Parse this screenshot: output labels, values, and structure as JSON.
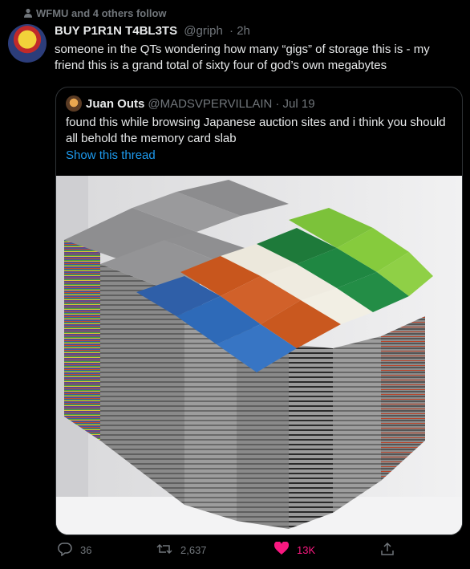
{
  "social_context": {
    "icon": "person-icon",
    "text": "WFMU and 4 others follow"
  },
  "tweet": {
    "author_name": "BUY P1R1N T4BL3TS",
    "handle": "@griph",
    "time": "· 2h",
    "text": "someone in the QTs wondering how many “gigs” of storage this is - my friend this is a grand total of sixty four of god’s own megabytes"
  },
  "quote": {
    "author_name": "Juan Outs",
    "handle": "@MADSVPERVILLAIN",
    "time": "· Jul 19",
    "text": "found this while browsing Japanese auction sites and i think you should all behold the memory card slab",
    "show_thread": "Show this thread"
  },
  "actions": {
    "reply_count": "36",
    "retweet_count": "2,637",
    "like_count": "13K",
    "like_color": "#f91880",
    "muted_color": "#71767b",
    "link_color": "#1d9bf0"
  }
}
